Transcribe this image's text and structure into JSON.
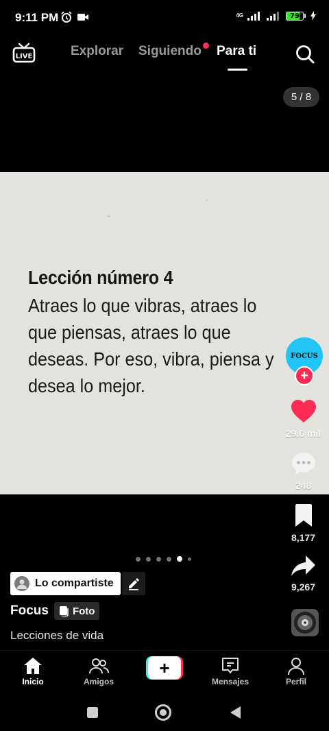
{
  "status_bar": {
    "time": "9:11 PM",
    "network": "4G",
    "battery_level": "79",
    "battery_fraction": 0.79
  },
  "top_nav": {
    "live_label": "LIVE",
    "tabs": [
      {
        "label": "Explorar",
        "active": false
      },
      {
        "label": "Siguiendo",
        "active": false,
        "has_notification": true
      },
      {
        "label": "Para ti",
        "active": true
      }
    ]
  },
  "photo": {
    "counter": "5 / 8",
    "lesson_title": "Lección número 4",
    "lesson_lines": [
      "Atraes lo que vibras, atraes lo",
      "que piensas, atraes lo que",
      "deseas. Por eso, vibra, piensa y",
      "desea lo mejor."
    ],
    "total_slides": 6,
    "active_slide_index": 4
  },
  "right_rail": {
    "avatar_text": "FOCUS",
    "likes": "29.6 mil",
    "comments": "248",
    "saves": "8,177",
    "shares": "9,267",
    "colors": {
      "like": "#fe2c55",
      "follow": "#fe2c55",
      "avatar_bg": "#21c5f5"
    }
  },
  "post": {
    "shared_label": "Lo compartiste",
    "author": "Focus",
    "type_badge": "Foto",
    "caption": "Lecciones de vida"
  },
  "bottom_nav": {
    "items": [
      {
        "label": "Inicio",
        "icon": "home-icon",
        "active": true
      },
      {
        "label": "Amigos",
        "icon": "friends-icon",
        "active": false
      },
      {
        "label": "",
        "icon": "plus-icon",
        "active": false
      },
      {
        "label": "Mensajes",
        "icon": "messages-icon",
        "active": false
      },
      {
        "label": "Perfil",
        "icon": "profile-icon",
        "active": false
      }
    ]
  }
}
